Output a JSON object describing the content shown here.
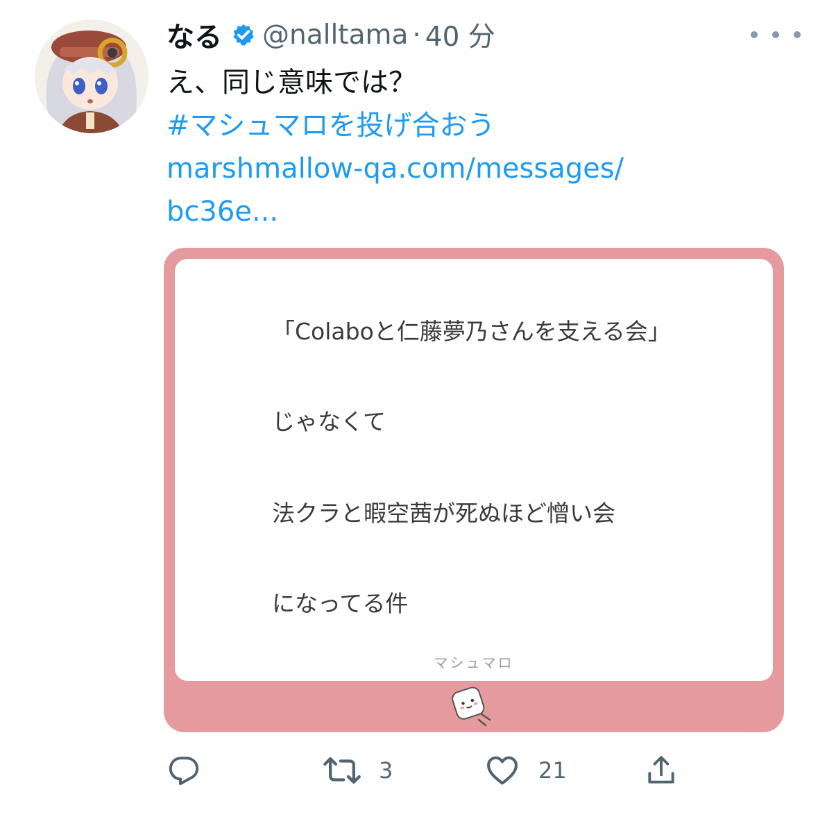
{
  "tweet": {
    "display_name": "なる",
    "handle": "@nalltama",
    "separator": "·",
    "time": "40 分",
    "text": "え、同じ意味では？",
    "hashtag": "#マシュマロを投げ合おう",
    "link_line1": "marshmallow-qa.com/messages/",
    "link_line2": "bc36e..."
  },
  "card": {
    "lines": [
      "「Colaboと仁藤夢乃さんを支える会」",
      "じゃなくて",
      "法クラと暇空茜が死ぬほど憎い会",
      "になってる件"
    ],
    "brand": "マシュマロ",
    "background_color": "#e59a9d"
  },
  "actions": {
    "reply_count": "",
    "retweet_count": "3",
    "like_count": "21"
  },
  "icons": {
    "verified": "verified-badge-icon",
    "reply": "reply-icon",
    "retweet": "retweet-icon",
    "like": "heart-icon",
    "share": "share-icon",
    "more": "more-dots-icon"
  },
  "colors": {
    "link": "#1d9bf0",
    "muted": "#536471",
    "verified": "#1d9bf0"
  }
}
